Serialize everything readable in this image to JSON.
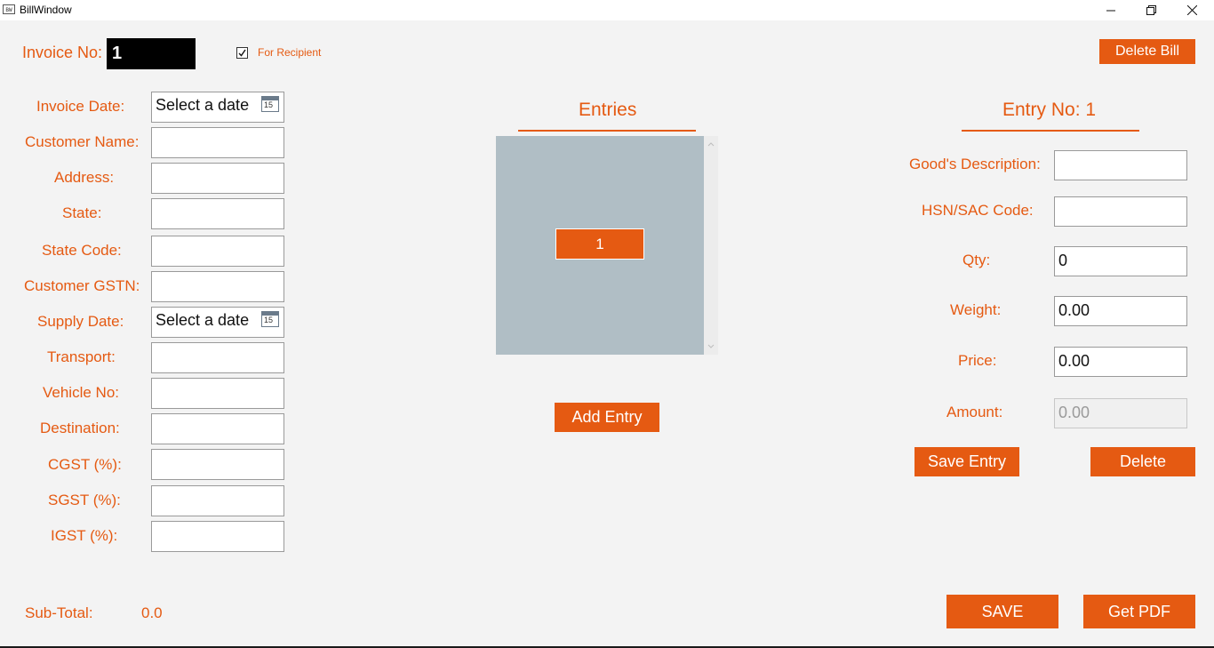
{
  "window": {
    "title": "BillWindow",
    "icon_text": "BW"
  },
  "header": {
    "invoice_label": "Invoice No:",
    "invoice_value": "1",
    "for_recipient_label": "For Recipient",
    "for_recipient_checked": true,
    "delete_bill_label": "Delete Bill"
  },
  "form": {
    "invoice_date_label": "Invoice Date:",
    "invoice_date_placeholder": "Select a date",
    "customer_name_label": "Customer Name:",
    "address_label": "Address:",
    "state_label": "State:",
    "state_code_label": "State Code:",
    "customer_gstn_label": "Customer GSTN:",
    "supply_date_label": "Supply Date:",
    "supply_date_placeholder": "Select a date",
    "transport_label": "Transport:",
    "vehicle_no_label": "Vehicle No:",
    "destination_label": "Destination:",
    "cgst_label": "CGST (%):",
    "sgst_label": "SGST (%):",
    "igst_label": "IGST (%):",
    "calendar_day": "15"
  },
  "entries": {
    "heading": "Entries",
    "items": [
      "1"
    ],
    "add_label": "Add Entry"
  },
  "entry": {
    "heading": "Entry No: 1",
    "description_label": "Good's Description:",
    "hsn_label": "HSN/SAC Code:",
    "qty_label": "Qty:",
    "qty_value": "0",
    "weight_label": "Weight:",
    "weight_value": "0.00",
    "price_label": "Price:",
    "price_value": "0.00",
    "amount_label": "Amount:",
    "amount_value": "0.00",
    "save_label": "Save Entry",
    "delete_label": "Delete"
  },
  "footer": {
    "subtotal_label": "Sub-Total:",
    "subtotal_value": "0.0",
    "save_label": "SAVE",
    "pdf_label": "Get PDF"
  },
  "colors": {
    "accent": "#e55a12",
    "list_bg": "#b0bec5"
  }
}
